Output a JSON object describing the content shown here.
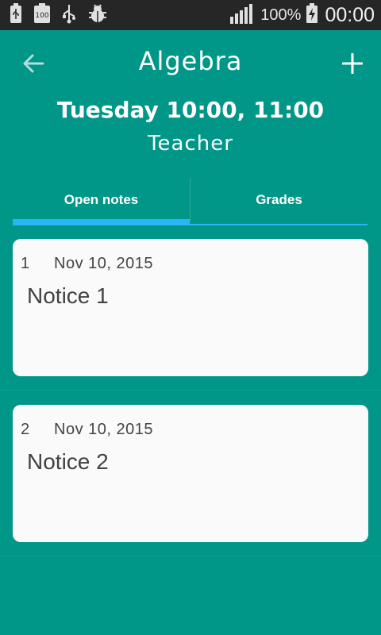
{
  "status_bar": {
    "icons": [
      "usb-icon",
      "battery-100-icon",
      "usb-icon",
      "debug-bug-icon"
    ],
    "signal_icon": "signal-bars-icon",
    "battery_percent": "100%",
    "battery_icon": "battery-charging-icon",
    "time": "00:00"
  },
  "app_bar": {
    "back_icon": "arrow-left-icon",
    "title": "Algebra",
    "add_icon": "plus-icon"
  },
  "subject": {
    "schedule": "Tuesday 10:00, 11:00",
    "teacher": "Teacher"
  },
  "tabs": [
    {
      "label": "Open notes",
      "selected": true
    },
    {
      "label": "Grades",
      "selected": false
    }
  ],
  "notes": [
    {
      "number": "1",
      "date": "Nov 10, 2015",
      "title": "Notice 1"
    },
    {
      "number": "2",
      "date": "Nov 10, 2015",
      "title": "Notice 2"
    }
  ],
  "colors": {
    "background": "#009688",
    "accent": "#29b6f6",
    "card": "#fafafa",
    "status_bar": "#262626"
  }
}
